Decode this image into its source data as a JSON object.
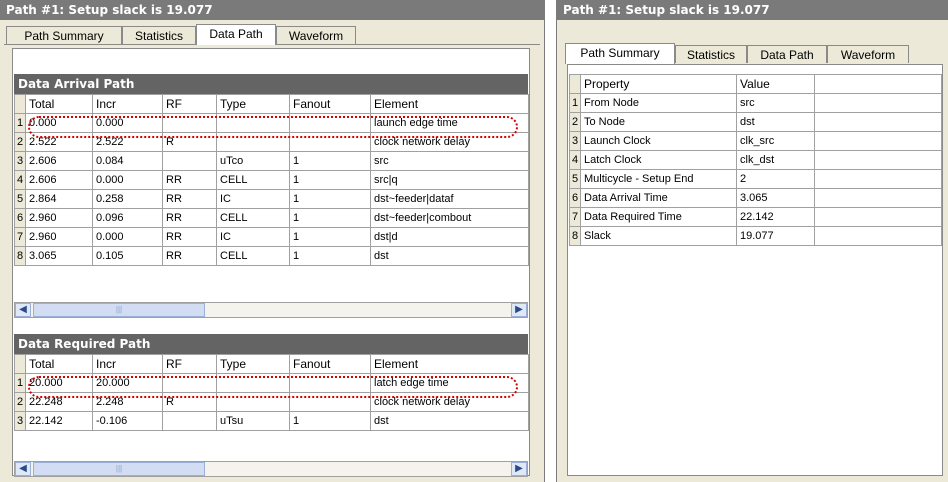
{
  "left": {
    "title": "Path #1: Setup slack is 19.077",
    "tabs": [
      "Path Summary",
      "Statistics",
      "Data Path",
      "Waveform"
    ],
    "arrival": {
      "header": "Data Arrival Path",
      "columns": [
        "Total",
        "Incr",
        "RF",
        "Type",
        "Fanout",
        "Element"
      ],
      "rows": [
        {
          "n": "1",
          "cells": [
            "0.000",
            "0.000",
            "",
            "",
            "",
            "launch edge time"
          ]
        },
        {
          "n": "2",
          "cells": [
            "2.522",
            "2.522",
            "R",
            "",
            "",
            "clock network delay"
          ]
        },
        {
          "n": "3",
          "cells": [
            "2.606",
            "0.084",
            "",
            "uTco",
            "1",
            "src"
          ]
        },
        {
          "n": "4",
          "cells": [
            "2.606",
            "0.000",
            "RR",
            "CELL",
            "1",
            "src|q"
          ]
        },
        {
          "n": "5",
          "cells": [
            "2.864",
            "0.258",
            "RR",
            "IC",
            "1",
            "dst~feeder|dataf"
          ]
        },
        {
          "n": "6",
          "cells": [
            "2.960",
            "0.096",
            "RR",
            "CELL",
            "1",
            "dst~feeder|combout"
          ]
        },
        {
          "n": "7",
          "cells": [
            "2.960",
            "0.000",
            "RR",
            "IC",
            "1",
            "dst|d"
          ]
        },
        {
          "n": "8",
          "cells": [
            "3.065",
            "0.105",
            "RR",
            "CELL",
            "1",
            "dst"
          ]
        }
      ]
    },
    "required": {
      "header": "Data Required Path",
      "columns": [
        "Total",
        "Incr",
        "RF",
        "Type",
        "Fanout",
        "Element"
      ],
      "rows": [
        {
          "n": "1",
          "cells": [
            "20.000",
            "20.000",
            "",
            "",
            "",
            "latch edge time"
          ]
        },
        {
          "n": "2",
          "cells": [
            "22.248",
            "2.248",
            "R",
            "",
            "",
            "clock network delay"
          ]
        },
        {
          "n": "3",
          "cells": [
            "22.142",
            "-0.106",
            "",
            "uTsu",
            "1",
            "dst"
          ]
        }
      ]
    }
  },
  "right": {
    "title": "Path #1: Setup slack is 19.077",
    "tabs": [
      "Path Summary",
      "Statistics",
      "Data Path",
      "Waveform"
    ],
    "columns": [
      "Property",
      "Value"
    ],
    "rows": [
      {
        "n": "1",
        "cells": [
          "From Node",
          "src"
        ]
      },
      {
        "n": "2",
        "cells": [
          "To Node",
          "dst"
        ]
      },
      {
        "n": "3",
        "cells": [
          "Launch Clock",
          "clk_src"
        ]
      },
      {
        "n": "4",
        "cells": [
          "Latch Clock",
          "clk_dst"
        ]
      },
      {
        "n": "5",
        "cells": [
          "Multicycle - Setup End",
          "2"
        ]
      },
      {
        "n": "6",
        "cells": [
          "Data Arrival Time",
          "3.065"
        ]
      },
      {
        "n": "7",
        "cells": [
          "Data Required Time",
          "22.142"
        ]
      },
      {
        "n": "8",
        "cells": [
          "Slack",
          "19.077"
        ]
      }
    ]
  },
  "icons": {
    "scroll_left": "scroll-left-arrow-icon",
    "scroll_right": "scroll-right-arrow-icon"
  },
  "colors": {
    "highlight": "#d40000",
    "title_bar": "#7a7a7a",
    "section_header": "#646464"
  }
}
